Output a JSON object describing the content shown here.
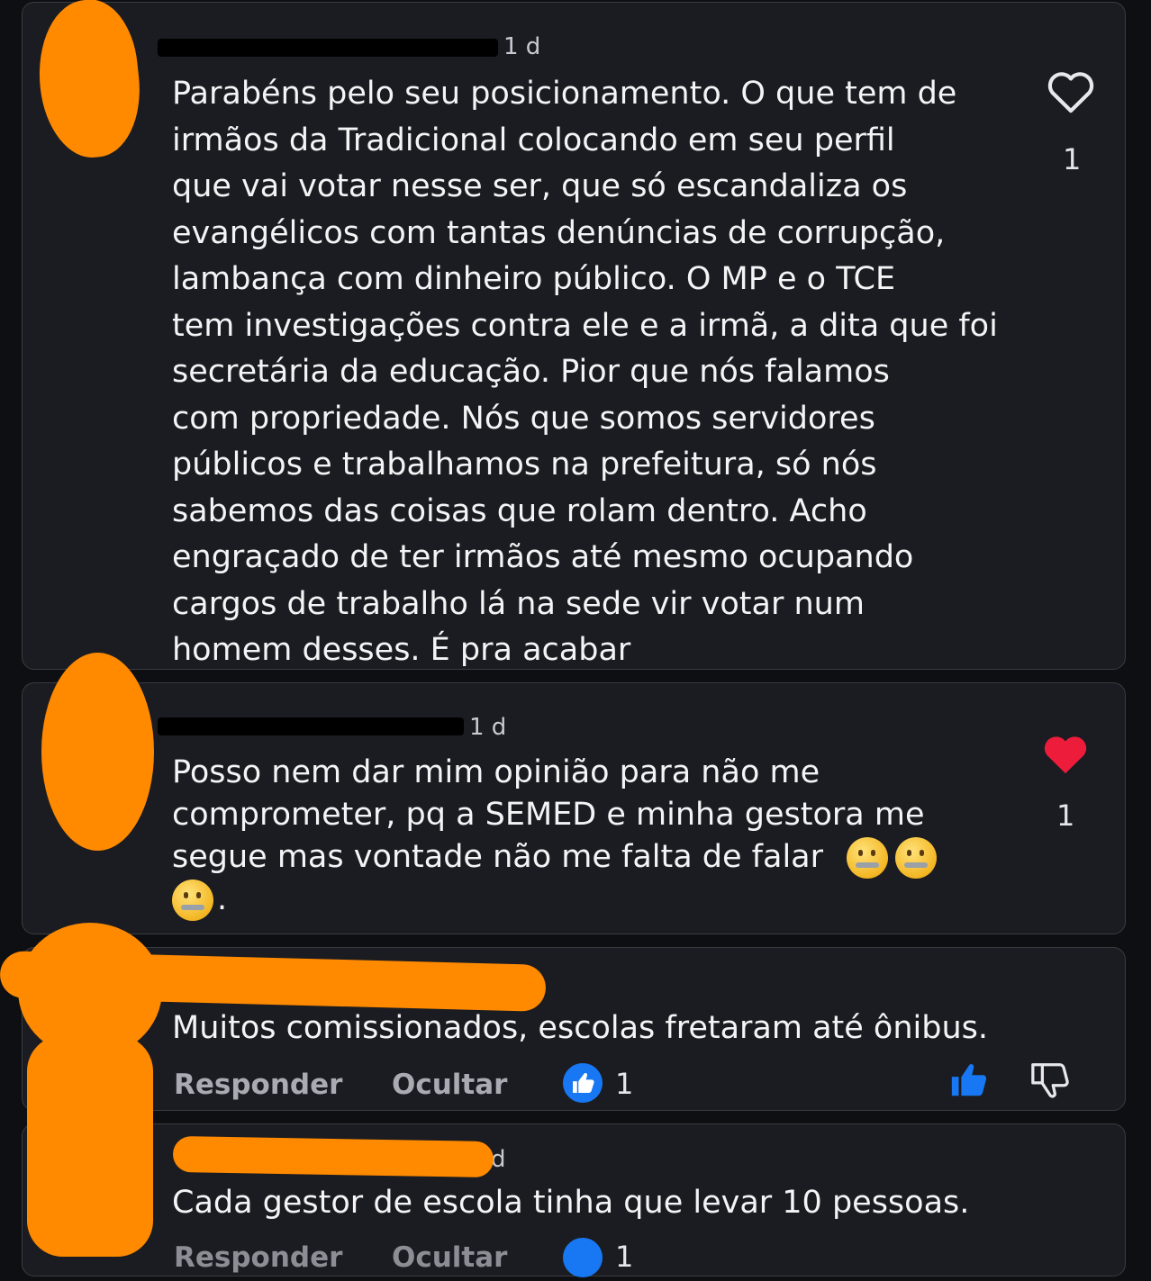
{
  "comments": [
    {
      "time": "1 d",
      "text": "Parabéns pelo seu posicionamento. O que tem de\nirmãos da Tradicional colocando em seu perfil\nque vai votar nesse ser, que só escandaliza os\nevangélicos com tantas denúncias de corrupção,\nlambança com dinheiro público.  O MP e o TCE\ntem investigações contra ele e a irmã, a dita que foi\nsecretária da educação.  Pior que nós falamos\ncom propriedade. Nós que somos servidores\npúblicos e trabalhamos na prefeitura, só nós\nsabemos das coisas que rolam dentro.  Acho\nengraçado de ter irmãos até mesmo ocupando\ncargos de trabalho lá na sede vir votar num\nhomem desses.  É pra acabar",
      "like_count": "1",
      "like_icon": "heart-outline-icon"
    },
    {
      "time": "1 d",
      "text_line1": "Posso nem dar mim opinião para não me",
      "text_line2": "comprometer, pq a SEMED e minha gestora me",
      "text_line3": "segue mas vontade não me falta de falar",
      "text_line4_suffix": ".",
      "emoji": "zipper-mouth-face",
      "like_count": "1",
      "like_icon": "heart-filled-icon",
      "like_color": "#ee1c3b"
    },
    {
      "text": "Muitos comissionados, escolas fretaram até ônibus.",
      "reply_label": "Responder",
      "hide_label": "Ocultar",
      "like_count": "1",
      "like_color": "#1877f2"
    },
    {
      "time": "d",
      "text": "Cada gestor de escola tinha que levar 10 pessoas.",
      "reply_label": "Responder",
      "hide_label": "Ocultar",
      "like_count": "1"
    }
  ]
}
